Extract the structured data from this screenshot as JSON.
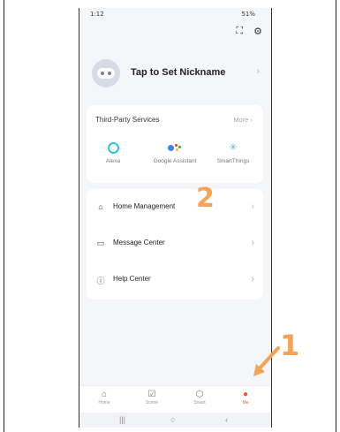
{
  "status": {
    "time": "1:12",
    "right": "51%"
  },
  "profile": {
    "nickname": "Tap to Set Nickname"
  },
  "third_party": {
    "title": "Third-Party Services",
    "more": "More",
    "services": [
      "Alexa",
      "Google Assistant",
      "SmartThings"
    ]
  },
  "menu": [
    {
      "label": "Home Management",
      "icon": "home-icon"
    },
    {
      "label": "Message Center",
      "icon": "message-icon"
    },
    {
      "label": "Help Center",
      "icon": "help-icon"
    }
  ],
  "annotations": {
    "one": "1",
    "two": "2"
  },
  "tabs": [
    {
      "label": "Home",
      "icon": "home-icon"
    },
    {
      "label": "Scene",
      "icon": "scene-icon"
    },
    {
      "label": "Smart",
      "icon": "smart-icon"
    },
    {
      "label": "Me",
      "icon": "me-icon"
    }
  ],
  "colors": {
    "accent": "#f05a24",
    "annotation": "#f4a455"
  }
}
